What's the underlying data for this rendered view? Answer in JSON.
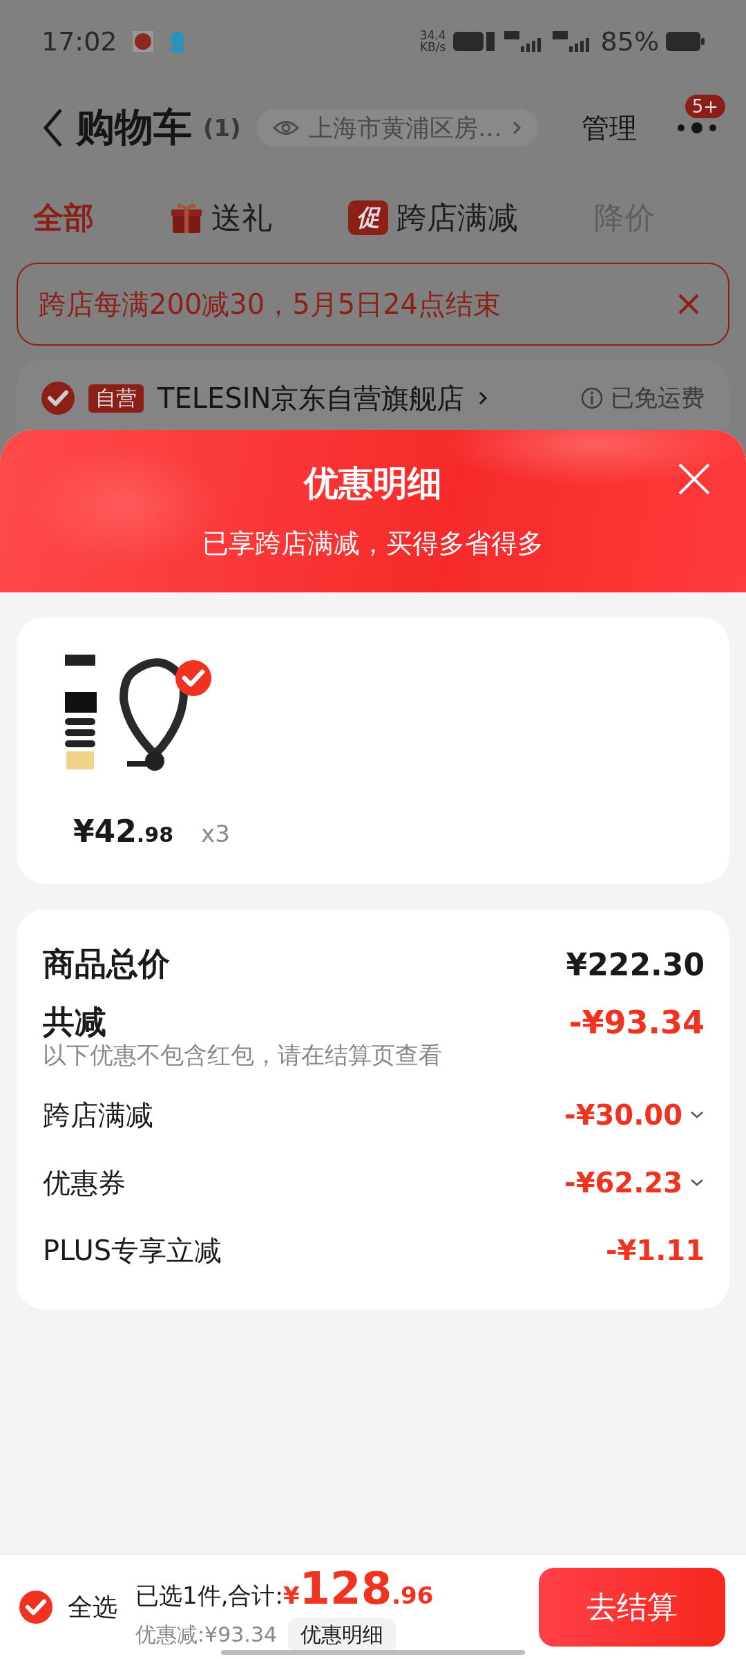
{
  "status_bar": {
    "time": "17:02",
    "net_speed": "34.4",
    "net_unit": "KB/s",
    "battery": "85%"
  },
  "header": {
    "title": "购物车",
    "count": "(1)",
    "location": "上海市黄浦区房…",
    "manage": "管理",
    "badge": "5+"
  },
  "tabs": [
    {
      "label": "全部",
      "kind": "plain",
      "selected": true
    },
    {
      "label": "送礼",
      "kind": "gift",
      "selected": false
    },
    {
      "label": "跨店满减",
      "kind": "promo",
      "badge": "促",
      "selected": false
    },
    {
      "label": "降价",
      "kind": "plain",
      "selected": false
    }
  ],
  "promo_banner": {
    "text": "跨店每满200减30，5月5日24点结束"
  },
  "store": {
    "selected": true,
    "tag": "自营",
    "name": "TELESIN京东自营旗舰店",
    "shipping": "已免运费"
  },
  "sheet": {
    "title": "优惠明细",
    "subtitle": "已享跨店满减，买得多省得多",
    "product": {
      "kind": "picture",
      "selected": true,
      "price_int": "¥42",
      "price_dec": ".98",
      "qty": "x3"
    },
    "summary": [
      {
        "kind": "total",
        "label": "商品总价",
        "amount": "¥222.30"
      },
      {
        "kind": "reduction",
        "label": "共减",
        "amount": "-¥93.34",
        "note": "以下优惠不包含红包，请在结算页查看"
      },
      {
        "kind": "expandable",
        "label": "跨店满减",
        "amount": "-¥30.00"
      },
      {
        "kind": "expandable",
        "label": "优惠券",
        "amount": "-¥62.23"
      },
      {
        "kind": "item",
        "label": "PLUS专享立减",
        "amount": "-¥1.11"
      }
    ]
  },
  "bottom_bar": {
    "select_all": true,
    "select_all_label": "全选",
    "selected_text": "已选1件,合计:",
    "currency": "¥",
    "total_int": "128",
    "total_dec": ".96",
    "saved": "优惠减:¥93.34",
    "detail_button": "优惠明细",
    "checkout": "去结算"
  }
}
